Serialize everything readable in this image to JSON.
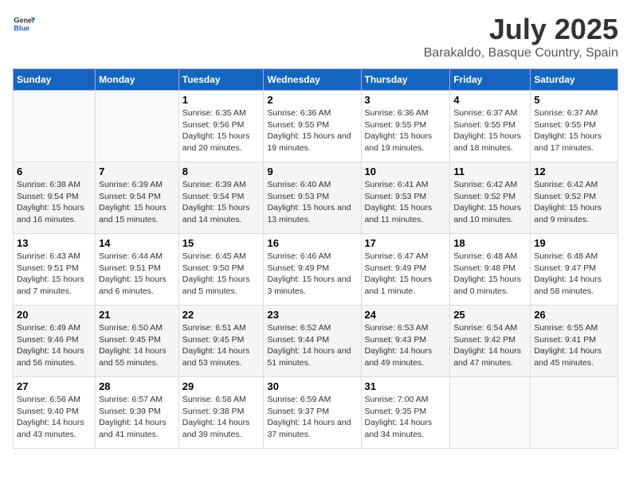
{
  "header": {
    "logo_general": "General",
    "logo_blue": "Blue",
    "title": "July 2025",
    "subtitle": "Barakaldo, Basque Country, Spain"
  },
  "weekdays": [
    "Sunday",
    "Monday",
    "Tuesday",
    "Wednesday",
    "Thursday",
    "Friday",
    "Saturday"
  ],
  "weeks": [
    [
      {
        "day": "",
        "info": ""
      },
      {
        "day": "",
        "info": ""
      },
      {
        "day": "1",
        "info": "Sunrise: 6:35 AM\nSunset: 9:56 PM\nDaylight: 15 hours and 20 minutes."
      },
      {
        "day": "2",
        "info": "Sunrise: 6:36 AM\nSunset: 9:55 PM\nDaylight: 15 hours and 19 minutes."
      },
      {
        "day": "3",
        "info": "Sunrise: 6:36 AM\nSunset: 9:55 PM\nDaylight: 15 hours and 19 minutes."
      },
      {
        "day": "4",
        "info": "Sunrise: 6:37 AM\nSunset: 9:55 PM\nDaylight: 15 hours and 18 minutes."
      },
      {
        "day": "5",
        "info": "Sunrise: 6:37 AM\nSunset: 9:55 PM\nDaylight: 15 hours and 17 minutes."
      }
    ],
    [
      {
        "day": "6",
        "info": "Sunrise: 6:38 AM\nSunset: 9:54 PM\nDaylight: 15 hours and 16 minutes."
      },
      {
        "day": "7",
        "info": "Sunrise: 6:39 AM\nSunset: 9:54 PM\nDaylight: 15 hours and 15 minutes."
      },
      {
        "day": "8",
        "info": "Sunrise: 6:39 AM\nSunset: 9:54 PM\nDaylight: 15 hours and 14 minutes."
      },
      {
        "day": "9",
        "info": "Sunrise: 6:40 AM\nSunset: 9:53 PM\nDaylight: 15 hours and 13 minutes."
      },
      {
        "day": "10",
        "info": "Sunrise: 6:41 AM\nSunset: 9:53 PM\nDaylight: 15 hours and 11 minutes."
      },
      {
        "day": "11",
        "info": "Sunrise: 6:42 AM\nSunset: 9:52 PM\nDaylight: 15 hours and 10 minutes."
      },
      {
        "day": "12",
        "info": "Sunrise: 6:42 AM\nSunset: 9:52 PM\nDaylight: 15 hours and 9 minutes."
      }
    ],
    [
      {
        "day": "13",
        "info": "Sunrise: 6:43 AM\nSunset: 9:51 PM\nDaylight: 15 hours and 7 minutes."
      },
      {
        "day": "14",
        "info": "Sunrise: 6:44 AM\nSunset: 9:51 PM\nDaylight: 15 hours and 6 minutes."
      },
      {
        "day": "15",
        "info": "Sunrise: 6:45 AM\nSunset: 9:50 PM\nDaylight: 15 hours and 5 minutes."
      },
      {
        "day": "16",
        "info": "Sunrise: 6:46 AM\nSunset: 9:49 PM\nDaylight: 15 hours and 3 minutes."
      },
      {
        "day": "17",
        "info": "Sunrise: 6:47 AM\nSunset: 9:49 PM\nDaylight: 15 hours and 1 minute."
      },
      {
        "day": "18",
        "info": "Sunrise: 6:48 AM\nSunset: 9:48 PM\nDaylight: 15 hours and 0 minutes."
      },
      {
        "day": "19",
        "info": "Sunrise: 6:48 AM\nSunset: 9:47 PM\nDaylight: 14 hours and 58 minutes."
      }
    ],
    [
      {
        "day": "20",
        "info": "Sunrise: 6:49 AM\nSunset: 9:46 PM\nDaylight: 14 hours and 56 minutes."
      },
      {
        "day": "21",
        "info": "Sunrise: 6:50 AM\nSunset: 9:45 PM\nDaylight: 14 hours and 55 minutes."
      },
      {
        "day": "22",
        "info": "Sunrise: 6:51 AM\nSunset: 9:45 PM\nDaylight: 14 hours and 53 minutes."
      },
      {
        "day": "23",
        "info": "Sunrise: 6:52 AM\nSunset: 9:44 PM\nDaylight: 14 hours and 51 minutes."
      },
      {
        "day": "24",
        "info": "Sunrise: 6:53 AM\nSunset: 9:43 PM\nDaylight: 14 hours and 49 minutes."
      },
      {
        "day": "25",
        "info": "Sunrise: 6:54 AM\nSunset: 9:42 PM\nDaylight: 14 hours and 47 minutes."
      },
      {
        "day": "26",
        "info": "Sunrise: 6:55 AM\nSunset: 9:41 PM\nDaylight: 14 hours and 45 minutes."
      }
    ],
    [
      {
        "day": "27",
        "info": "Sunrise: 6:56 AM\nSunset: 9:40 PM\nDaylight: 14 hours and 43 minutes."
      },
      {
        "day": "28",
        "info": "Sunrise: 6:57 AM\nSunset: 9:39 PM\nDaylight: 14 hours and 41 minutes."
      },
      {
        "day": "29",
        "info": "Sunrise: 6:58 AM\nSunset: 9:38 PM\nDaylight: 14 hours and 39 minutes."
      },
      {
        "day": "30",
        "info": "Sunrise: 6:59 AM\nSunset: 9:37 PM\nDaylight: 14 hours and 37 minutes."
      },
      {
        "day": "31",
        "info": "Sunrise: 7:00 AM\nSunset: 9:35 PM\nDaylight: 14 hours and 34 minutes."
      },
      {
        "day": "",
        "info": ""
      },
      {
        "day": "",
        "info": ""
      }
    ]
  ]
}
